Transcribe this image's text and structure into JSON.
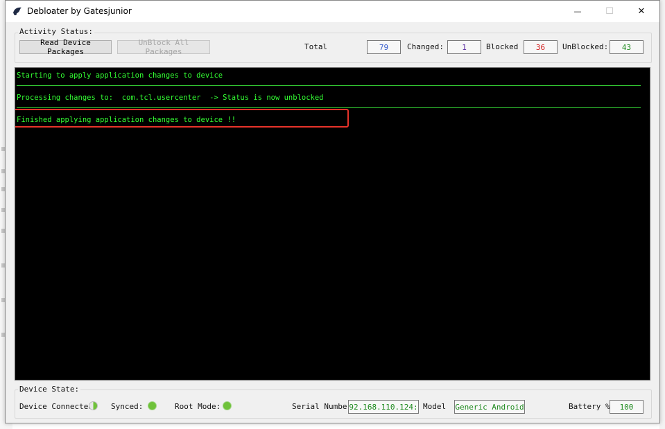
{
  "window": {
    "title": "Debloater by Gatesjunior",
    "minimize_glyph": "—",
    "maximize_glyph": "☐",
    "close_glyph": "✕"
  },
  "activity": {
    "group_label": "Activity Status:",
    "read_button": "Read Device Packages",
    "unblock_all_button": "UnBlock All Packages",
    "total_label": "Total",
    "total_value": "79",
    "changed_label": "Changed:",
    "changed_value": "1",
    "blocked_label": "Blocked",
    "blocked_value": "36",
    "unblocked_label": "UnBlocked:",
    "unblocked_value": "43"
  },
  "console": {
    "lines": [
      "Starting to apply application changes to device",
      "Processing changes to:  com.tcl.usercenter  -> Status is now unblocked",
      "Finished applying application changes to device !!"
    ]
  },
  "device": {
    "group_label": "Device State:",
    "connected_label": "Device Connected:",
    "synced_label": "Synced:",
    "root_label": "Root Mode:",
    "serial_label": "Serial Number:",
    "serial_value": "92.168.110.124:",
    "model_label": "Model",
    "model_value": "Generic Android",
    "battery_label": "Battery %:",
    "battery_value": "100"
  },
  "colors": {
    "console_bg": "#000000",
    "console_text": "#33ff33",
    "highlight": "#e8332a",
    "total_value": "#3a5fcd",
    "changed_value": "#5a2ca0",
    "blocked_value": "#d22020",
    "unblocked_value": "#1f8a1f",
    "status_led": "#6fc23a"
  },
  "icons": {
    "app": "app-logo-icon",
    "connected": "status-led-icon",
    "synced": "status-led-icon",
    "root": "status-led-icon"
  }
}
